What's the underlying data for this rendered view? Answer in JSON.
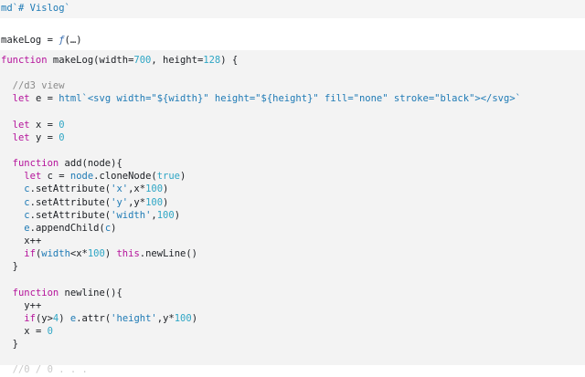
{
  "md_cell": {
    "prefix": "md",
    "content": "`# Vislog`"
  },
  "output_cell": {
    "label": "makeLog = ",
    "fn": "ƒ",
    "args": "(…)"
  },
  "code": {
    "l1_kw": "function",
    "l1_rest": " makeLog(width=",
    "l1_num1": "700",
    "l1_mid": ", height=",
    "l1_num2": "128",
    "l1_end": ") {",
    "l3_comment": "//d3 view",
    "l4_kw": "let",
    "l4_a": " e = ",
    "l4_html": "html",
    "l4_tpl_a": "`<svg width=\"${width}\" height=\"${height}\" fill=\"none\" stroke=\"black\"></svg>`",
    "l6_kw": "let",
    "l6_a": " x = ",
    "l6_num": "0",
    "l7_kw": "let",
    "l7_a": " y = ",
    "l7_num": "0",
    "l9_kw": "function",
    "l9_rest": " add(node){",
    "l10_kw": "let",
    "l10_a": " c = ",
    "l10_node": "node",
    "l10_b": ".cloneNode(",
    "l10_true": "true",
    "l10_end": ")",
    "l11_c": "c",
    "l11_a": ".setAttribute(",
    "l11_str": "'x'",
    "l11_b": ",x*",
    "l11_num": "100",
    "l11_end": ")",
    "l12_c": "c",
    "l12_a": ".setAttribute(",
    "l12_str": "'y'",
    "l12_b": ",y*",
    "l12_num": "100",
    "l12_end": ")",
    "l13_c": "c",
    "l13_a": ".setAttribute(",
    "l13_str": "'width'",
    "l13_b": ",",
    "l13_num": "100",
    "l13_end": ")",
    "l14_e": "e",
    "l14_a": ".appendChild(",
    "l14_c": "c",
    "l14_end": ")",
    "l15": "x++",
    "l16_kw": "if",
    "l16_a": "(",
    "l16_w": "width",
    "l16_b": "<x*",
    "l16_num": "100",
    "l16_c": ") ",
    "l16_this": "this",
    "l16_end": ".newLine()",
    "l17": "}",
    "l19_kw": "function",
    "l19_rest": " newline(){",
    "l20": "y++",
    "l21_kw": "if",
    "l21_a": "(y>",
    "l21_num": "4",
    "l21_b": ") ",
    "l21_e": "e",
    "l21_c": ".attr(",
    "l21_str": "'height'",
    "l21_d": ",y*",
    "l21_num2": "100",
    "l21_end": ")",
    "l22_a": "x = ",
    "l22_num": "0",
    "l23": "}",
    "l25_partial": "  //0 / 0 . . ."
  },
  "colors": {
    "keyword": "#b5139b",
    "number": "#2fa6c5",
    "string": "#1e7ab5",
    "comment": "#8a8a8a"
  }
}
